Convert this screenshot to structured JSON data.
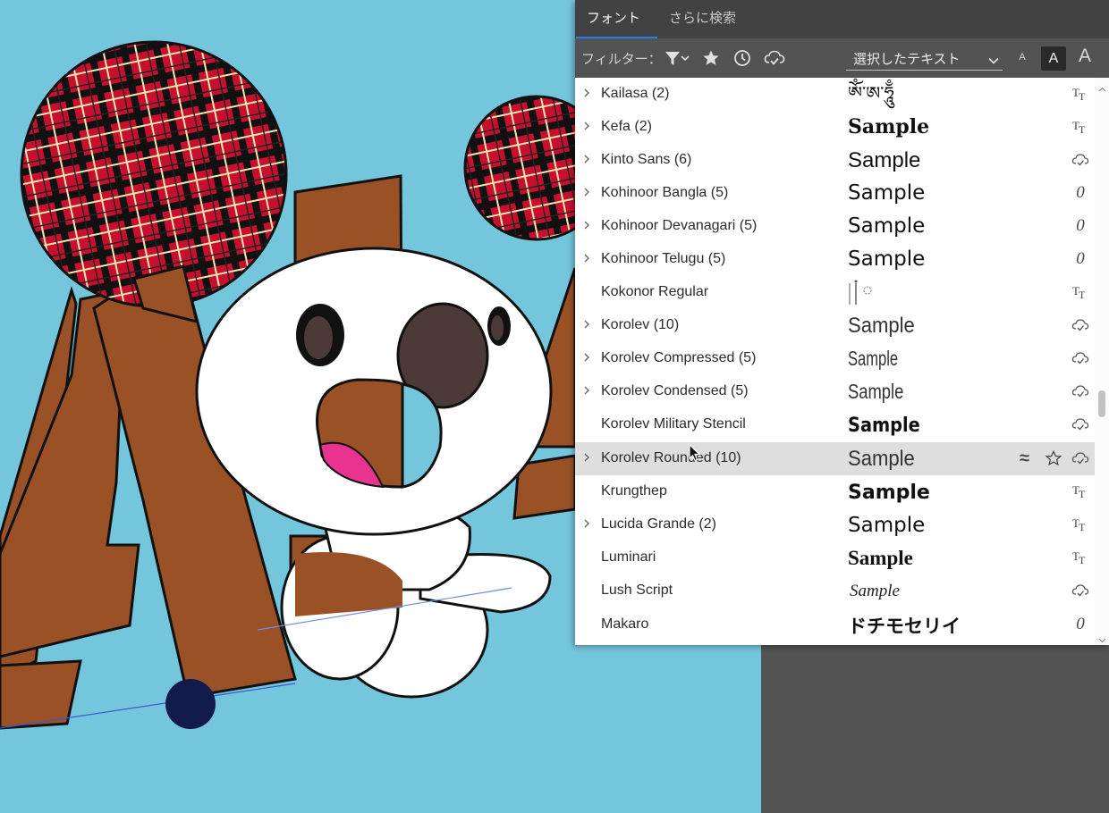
{
  "tabs": {
    "fonts": "フォント",
    "more": "さらに検索"
  },
  "filters": {
    "label": "フィルター：",
    "icons": [
      "filter-funnel-icon",
      "star-icon",
      "clock-icon",
      "cloud-check-icon"
    ]
  },
  "sample_text_dropdown": {
    "value": "選択したテキスト"
  },
  "size_buttons": {
    "small": "A",
    "medium": "A",
    "large": "A",
    "selected": "medium"
  },
  "fonts": [
    {
      "name": "Kailasa (2)",
      "sample": "ཨོཾ་ཨ་ཧཱུྃ",
      "expandable": true,
      "type": "TT"
    },
    {
      "name": "Kefa (2)",
      "sample": "Sample",
      "expandable": true,
      "type": "TT"
    },
    {
      "name": "Kinto Sans (6)",
      "sample": "Sample",
      "expandable": true,
      "type": "cloud"
    },
    {
      "name": "Kohinoor Bangla (5)",
      "sample": "Sample",
      "expandable": true,
      "type": "O"
    },
    {
      "name": "Kohinoor Devanagari (5)",
      "sample": "Sample",
      "expandable": true,
      "type": "O"
    },
    {
      "name": "Kohinoor Telugu (5)",
      "sample": "Sample",
      "expandable": true,
      "type": "O"
    },
    {
      "name": "Kokonor Regular",
      "sample": "",
      "expandable": false,
      "type": "TT"
    },
    {
      "name": "Korolev (10)",
      "sample": "Sample",
      "expandable": true,
      "type": "cloud"
    },
    {
      "name": "Korolev Compressed (5)",
      "sample": "Sample",
      "expandable": true,
      "type": "cloud"
    },
    {
      "name": "Korolev Condensed (5)",
      "sample": "Sample",
      "expandable": true,
      "type": "cloud"
    },
    {
      "name": "Korolev Military Stencil",
      "sample": "Sample",
      "expandable": false,
      "type": "cloud"
    },
    {
      "name": "Korolev Rounded (10)",
      "sample": "Sample",
      "expandable": true,
      "type": "cloud",
      "hovered": true
    },
    {
      "name": "Krungthep",
      "sample": "Sample",
      "expandable": false,
      "type": "TT"
    },
    {
      "name": "Lucida Grande (2)",
      "sample": "Sample",
      "expandable": true,
      "type": "TT"
    },
    {
      "name": "Luminari",
      "sample": "Sample",
      "expandable": false,
      "type": "TT"
    },
    {
      "name": "Lush Script",
      "sample": "Sample",
      "expandable": false,
      "type": "cloud"
    },
    {
      "name": "Makaro",
      "sample": "ドチモセリイ",
      "expandable": false,
      "type": "O"
    }
  ],
  "hover_actions": {
    "similar_icon": "≈",
    "favorite_icon": "star-outline-icon"
  },
  "colors": {
    "artboard": "#74c6dc",
    "panel": "#535353",
    "tab_accent": "#2680eb",
    "brown": "#9a5126",
    "plaid_red": "#c8102e",
    "nose": "#4b3a38",
    "mouth_pink": "#e8338f",
    "navy_dot": "#131b4d"
  }
}
